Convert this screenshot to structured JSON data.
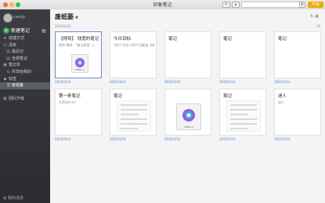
{
  "window": {
    "title": "印象笔记"
  },
  "toolbar": {
    "upgrade_label": "升级"
  },
  "sidebar": {
    "username": "candy",
    "new_note_label": "新建笔记",
    "items": [
      {
        "label": "快捷方式",
        "icon": "star-icon",
        "sub": false,
        "state": "normal"
      },
      {
        "label": "清单",
        "icon": "checklist-icon",
        "sub": false,
        "state": "normal"
      },
      {
        "label": "最后记",
        "icon": "note-icon",
        "sub": true,
        "state": "normal"
      },
      {
        "label": "全部笔记",
        "icon": "notes-icon",
        "sub": true,
        "state": "normal"
      },
      {
        "label": "笔记本",
        "icon": "notebook-icon",
        "sub": false,
        "state": "normal"
      },
      {
        "label": "共享给我的",
        "icon": "share-icon",
        "sub": true,
        "state": "normal"
      },
      {
        "label": "标签",
        "icon": "tag-icon",
        "sub": false,
        "state": "normal"
      },
      {
        "label": "废纸篓",
        "icon": "trash-icon",
        "sub": true,
        "state": "active"
      },
      {
        "label": "",
        "icon": "",
        "sub": true,
        "state": "muted"
      },
      {
        "label": "团队升级",
        "icon": "team-icon",
        "sub": false,
        "state": "normal"
      }
    ],
    "footer_label": "我的消息"
  },
  "main": {
    "title": "废纸篓",
    "date_group": "2020年3月",
    "count": "10"
  },
  "notes": [
    {
      "title": "【得到】 钱宽的笔记",
      "snippet": "得到 薄雨：“勇当高速”上..",
      "kind": "file",
      "file_label": "MPEG-4",
      "date": "2020/3/14",
      "selected": true
    },
    {
      "title": "今日目标",
      "snippet": "100个目标 100个功能这 字幕改进",
      "kind": "text",
      "date": "2020/3/14",
      "selected": false
    },
    {
      "title": "笔记",
      "snippet": "",
      "kind": "text",
      "date": "2020/3/14",
      "selected": false
    },
    {
      "title": "笔记",
      "snippet": "",
      "kind": "text",
      "date": "2020/3/14",
      "selected": false
    },
    {
      "title": "笔记",
      "snippet": "",
      "kind": "text",
      "date": "2020/3/14",
      "selected": false
    },
    {
      "title": "第一条笔记",
      "snippet": "东西为什么?",
      "kind": "text",
      "date": "2020/3/14",
      "selected": false
    },
    {
      "title": "笔记",
      "snippet": "",
      "kind": "doc",
      "date": "2020/3/14",
      "selected": false
    },
    {
      "title": "",
      "snippet": "",
      "kind": "file-big",
      "file_label": "MPEG-4",
      "date": "2020/3/14",
      "selected": false
    },
    {
      "title": "笔记",
      "snippet": "",
      "kind": "doc",
      "date": "2020/3/14",
      "selected": false
    },
    {
      "title": "迷人",
      "snippet": "迷人",
      "kind": "text",
      "date": "2020/3/14",
      "selected": false
    }
  ]
}
